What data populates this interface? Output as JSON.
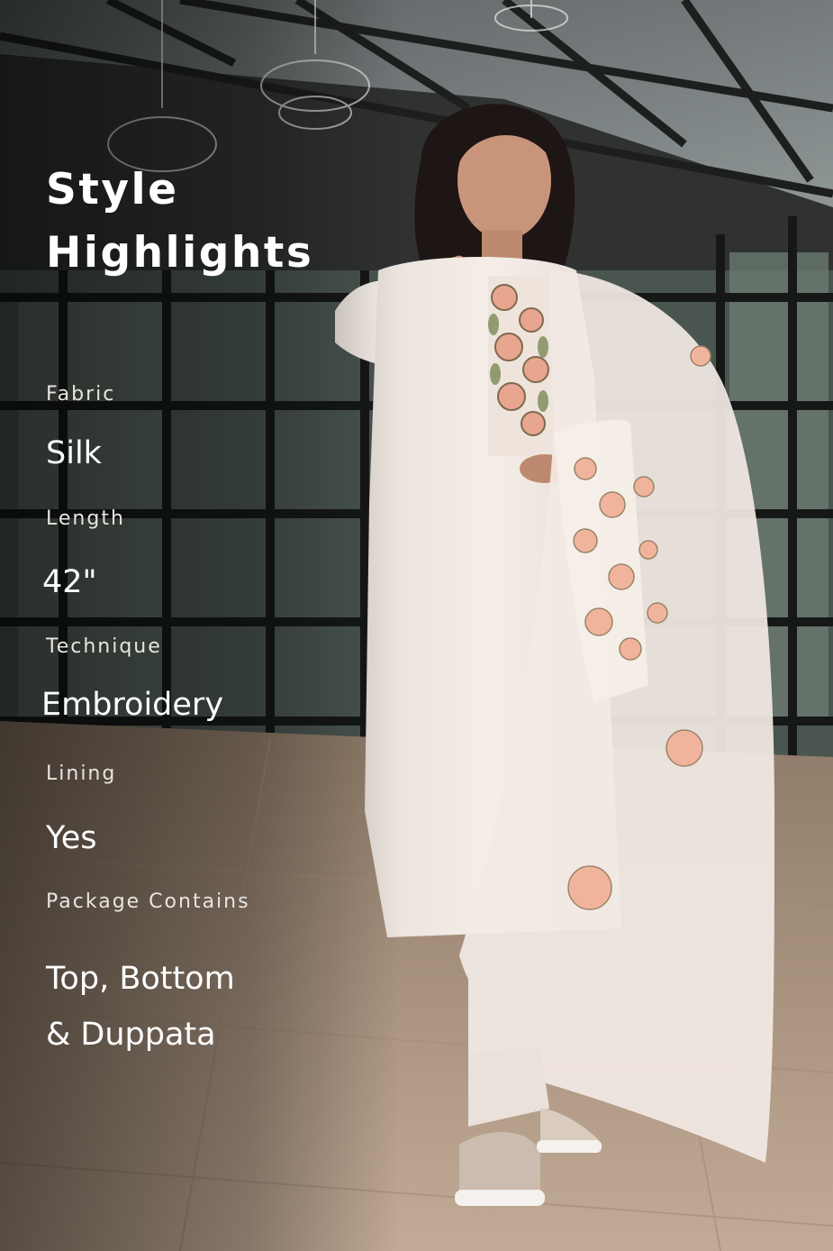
{
  "header": {
    "title": "Style\nHighlights"
  },
  "highlights": [
    {
      "label": "Fabric",
      "value": "Silk"
    },
    {
      "label": "Length",
      "value": "42\""
    },
    {
      "label": "Technique",
      "value": "Embroidery"
    },
    {
      "label": "Lining",
      "value": "Yes"
    },
    {
      "label": "Package Contains",
      "value": "Top, Bottom\n& Duppata"
    }
  ],
  "colors": {
    "text": "#ffffff",
    "label_text": "#e8e4e0",
    "outfit": "#f1e9e2",
    "floral_accent": "#e8a58f"
  }
}
